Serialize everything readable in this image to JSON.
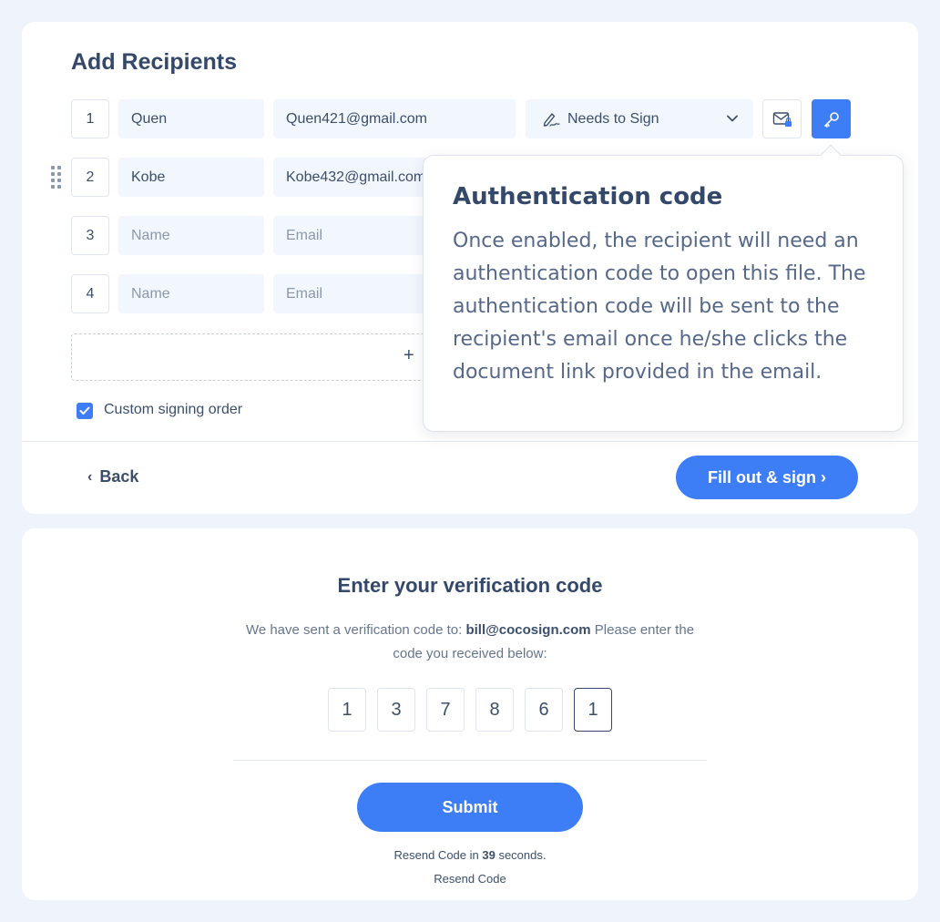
{
  "recipients": {
    "title": "Add Recipients",
    "rows": [
      {
        "index": "1",
        "name": "Quen",
        "email": "Quen421@gmail.com"
      },
      {
        "index": "2",
        "name": "Kobe",
        "email": "Kobe432@gmail.com"
      },
      {
        "index": "3",
        "name_placeholder": "Name",
        "email_placeholder": "Email"
      },
      {
        "index": "4",
        "name_placeholder": "Name",
        "email_placeholder": "Email"
      }
    ],
    "role": "Needs to Sign",
    "add_symbol": "+",
    "custom_order_label": "Custom signing order",
    "custom_order_checked": true,
    "back_label": "Back",
    "next_label": "Fill out & sign ›"
  },
  "tooltip": {
    "title": "Authentication code",
    "body": "Once enabled, the recipient will need an authentication code to open this file. The authentication code will be sent to the recipient's email once he/she clicks the document link provided in the email."
  },
  "verification": {
    "title": "Enter your verification code",
    "desc_prefix": "We have sent a verification code to: ",
    "email": "bill@cocosign.com",
    "desc_suffix": " Please enter the code you received below:",
    "digits": [
      "1",
      "3",
      "7",
      "8",
      "6",
      "1"
    ],
    "submit_label": "Submit",
    "resend_prefix": "Resend Code in ",
    "resend_seconds": "39",
    "resend_suffix": " seconds.",
    "resend_link": "Resend Code"
  },
  "colors": {
    "accent": "#3d7ef7",
    "text": "#3b4f6b",
    "background": "#eef3fc"
  },
  "icons": [
    "pen-signature-icon",
    "chevron-down-icon",
    "mail-lock-icon",
    "key-icon",
    "drag-handle-icon",
    "check-icon"
  ]
}
